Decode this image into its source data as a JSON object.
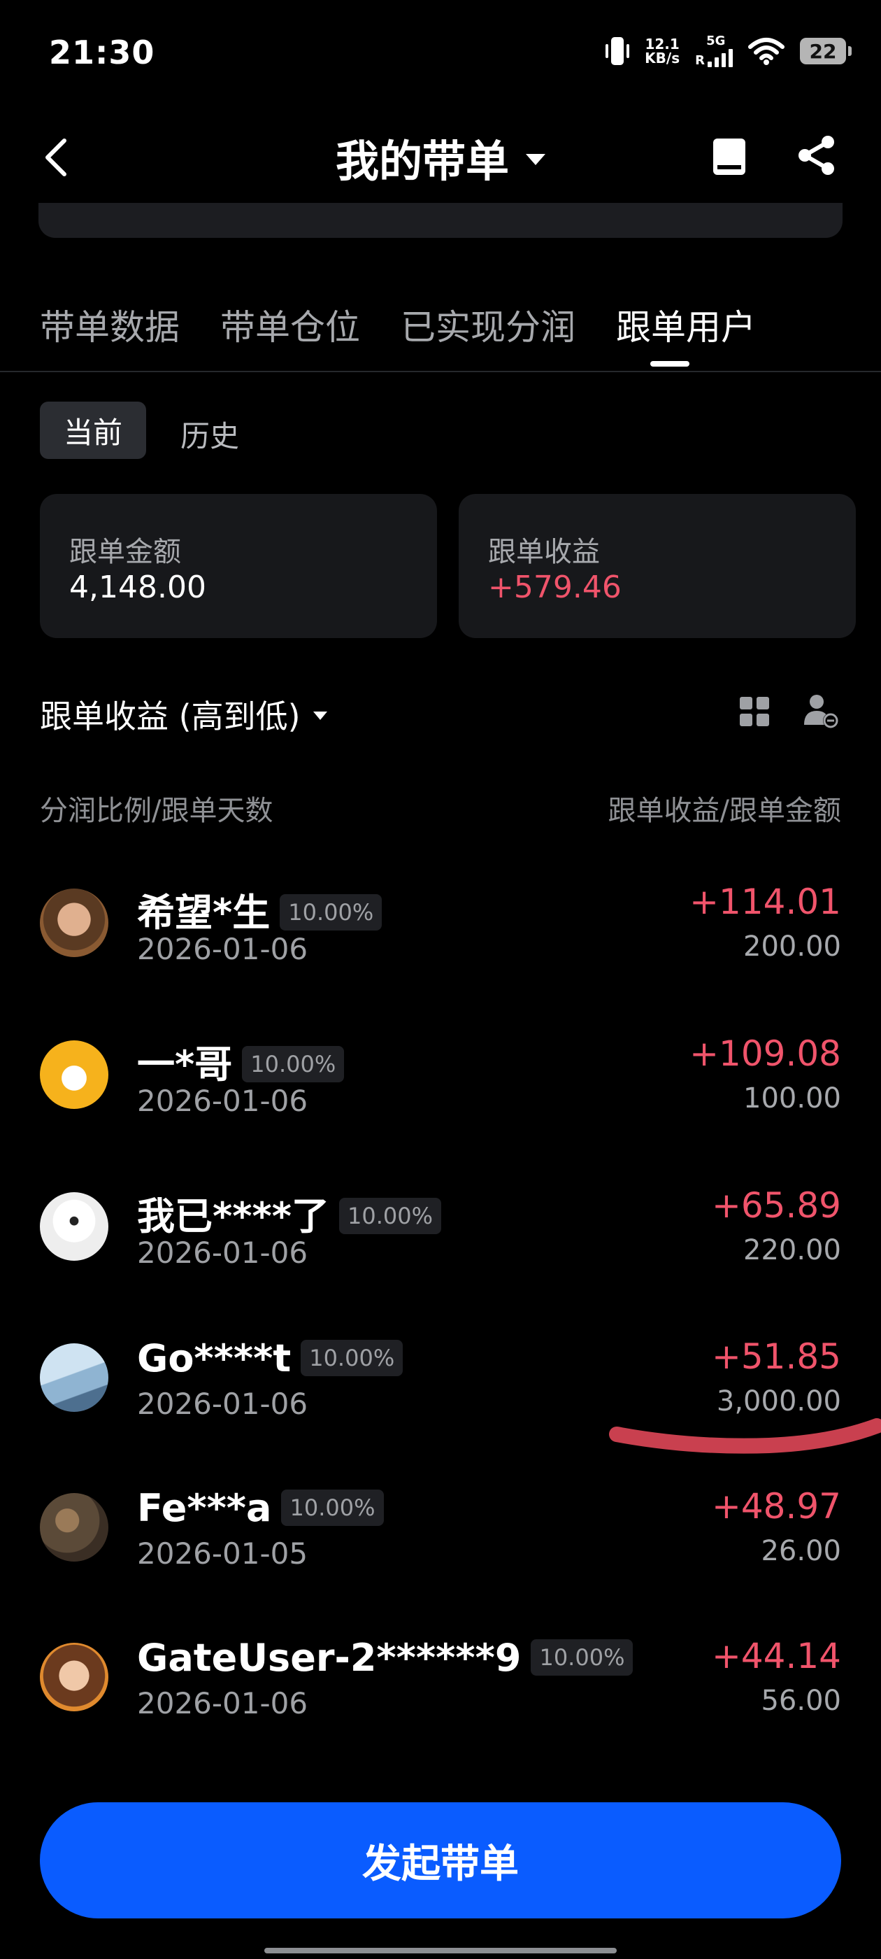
{
  "status": {
    "time": "21:30",
    "net_speed_value": "12.1",
    "net_speed_unit": "KB/s",
    "network": "5G",
    "roaming": "R",
    "battery": "22"
  },
  "header": {
    "title": "我的带单"
  },
  "tabs": [
    {
      "label": "带单数据"
    },
    {
      "label": "带单仓位"
    },
    {
      "label": "已实现分润"
    },
    {
      "label": "跟单用户"
    }
  ],
  "segment": {
    "current": "当前",
    "history": "历史"
  },
  "summary": {
    "amount_label": "跟单金额",
    "amount_value": "4,148.00",
    "profit_label": "跟单收益",
    "profit_value": "+579.46"
  },
  "sort": {
    "label": "跟单收益 (高到低)"
  },
  "columns": {
    "left": "分润比例/跟单天数",
    "right": "跟单收益/跟单金额"
  },
  "followers": [
    {
      "name": "希望*生",
      "ratio": "10.00%",
      "date": "2026-01-06",
      "profit": "+114.01",
      "amount": "200.00"
    },
    {
      "name": "一*哥",
      "ratio": "10.00%",
      "date": "2026-01-06",
      "profit": "+109.08",
      "amount": "100.00"
    },
    {
      "name": "我已****了",
      "ratio": "10.00%",
      "date": "2026-01-06",
      "profit": "+65.89",
      "amount": "220.00"
    },
    {
      "name": "Go****t",
      "ratio": "10.00%",
      "date": "2026-01-06",
      "profit": "+51.85",
      "amount": "3,000.00"
    },
    {
      "name": "Fe***a",
      "ratio": "10.00%",
      "date": "2026-01-05",
      "profit": "+48.97",
      "amount": "26.00"
    },
    {
      "name": "GateUser-2******9",
      "ratio": "10.00%",
      "date": "2026-01-06",
      "profit": "+44.14",
      "amount": "56.00"
    }
  ],
  "cta": {
    "label": "发起带单"
  },
  "colors": {
    "background": "#000000",
    "card": "#17181b",
    "profit_red": "#f0546b",
    "cta_blue": "#0a5cff",
    "annotation_red": "#c9404f"
  }
}
